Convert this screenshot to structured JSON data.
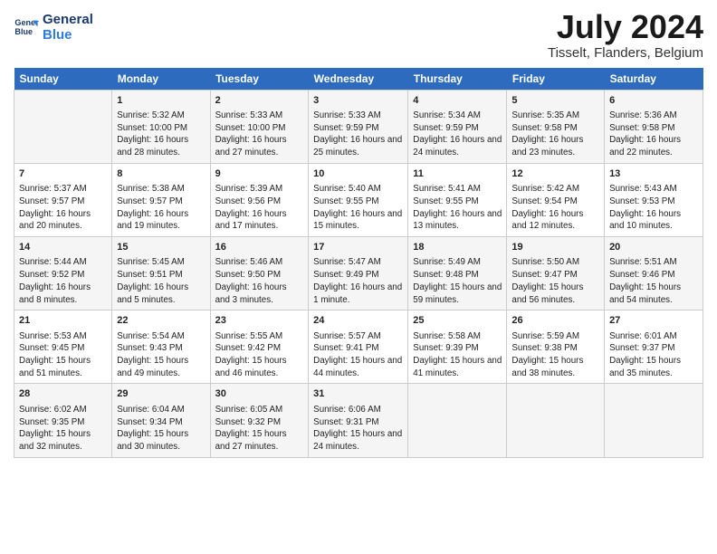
{
  "header": {
    "logo_line1": "General",
    "logo_line2": "Blue",
    "month": "July 2024",
    "location": "Tisselt, Flanders, Belgium"
  },
  "weekdays": [
    "Sunday",
    "Monday",
    "Tuesday",
    "Wednesday",
    "Thursday",
    "Friday",
    "Saturday"
  ],
  "weeks": [
    [
      {
        "day": "",
        "info": ""
      },
      {
        "day": "1",
        "info": "Sunrise: 5:32 AM\nSunset: 10:00 PM\nDaylight: 16 hours and 28 minutes."
      },
      {
        "day": "2",
        "info": "Sunrise: 5:33 AM\nSunset: 10:00 PM\nDaylight: 16 hours and 27 minutes."
      },
      {
        "day": "3",
        "info": "Sunrise: 5:33 AM\nSunset: 9:59 PM\nDaylight: 16 hours and 25 minutes."
      },
      {
        "day": "4",
        "info": "Sunrise: 5:34 AM\nSunset: 9:59 PM\nDaylight: 16 hours and 24 minutes."
      },
      {
        "day": "5",
        "info": "Sunrise: 5:35 AM\nSunset: 9:58 PM\nDaylight: 16 hours and 23 minutes."
      },
      {
        "day": "6",
        "info": "Sunrise: 5:36 AM\nSunset: 9:58 PM\nDaylight: 16 hours and 22 minutes."
      }
    ],
    [
      {
        "day": "7",
        "info": "Sunrise: 5:37 AM\nSunset: 9:57 PM\nDaylight: 16 hours and 20 minutes."
      },
      {
        "day": "8",
        "info": "Sunrise: 5:38 AM\nSunset: 9:57 PM\nDaylight: 16 hours and 19 minutes."
      },
      {
        "day": "9",
        "info": "Sunrise: 5:39 AM\nSunset: 9:56 PM\nDaylight: 16 hours and 17 minutes."
      },
      {
        "day": "10",
        "info": "Sunrise: 5:40 AM\nSunset: 9:55 PM\nDaylight: 16 hours and 15 minutes."
      },
      {
        "day": "11",
        "info": "Sunrise: 5:41 AM\nSunset: 9:55 PM\nDaylight: 16 hours and 13 minutes."
      },
      {
        "day": "12",
        "info": "Sunrise: 5:42 AM\nSunset: 9:54 PM\nDaylight: 16 hours and 12 minutes."
      },
      {
        "day": "13",
        "info": "Sunrise: 5:43 AM\nSunset: 9:53 PM\nDaylight: 16 hours and 10 minutes."
      }
    ],
    [
      {
        "day": "14",
        "info": "Sunrise: 5:44 AM\nSunset: 9:52 PM\nDaylight: 16 hours and 8 minutes."
      },
      {
        "day": "15",
        "info": "Sunrise: 5:45 AM\nSunset: 9:51 PM\nDaylight: 16 hours and 5 minutes."
      },
      {
        "day": "16",
        "info": "Sunrise: 5:46 AM\nSunset: 9:50 PM\nDaylight: 16 hours and 3 minutes."
      },
      {
        "day": "17",
        "info": "Sunrise: 5:47 AM\nSunset: 9:49 PM\nDaylight: 16 hours and 1 minute."
      },
      {
        "day": "18",
        "info": "Sunrise: 5:49 AM\nSunset: 9:48 PM\nDaylight: 15 hours and 59 minutes."
      },
      {
        "day": "19",
        "info": "Sunrise: 5:50 AM\nSunset: 9:47 PM\nDaylight: 15 hours and 56 minutes."
      },
      {
        "day": "20",
        "info": "Sunrise: 5:51 AM\nSunset: 9:46 PM\nDaylight: 15 hours and 54 minutes."
      }
    ],
    [
      {
        "day": "21",
        "info": "Sunrise: 5:53 AM\nSunset: 9:45 PM\nDaylight: 15 hours and 51 minutes."
      },
      {
        "day": "22",
        "info": "Sunrise: 5:54 AM\nSunset: 9:43 PM\nDaylight: 15 hours and 49 minutes."
      },
      {
        "day": "23",
        "info": "Sunrise: 5:55 AM\nSunset: 9:42 PM\nDaylight: 15 hours and 46 minutes."
      },
      {
        "day": "24",
        "info": "Sunrise: 5:57 AM\nSunset: 9:41 PM\nDaylight: 15 hours and 44 minutes."
      },
      {
        "day": "25",
        "info": "Sunrise: 5:58 AM\nSunset: 9:39 PM\nDaylight: 15 hours and 41 minutes."
      },
      {
        "day": "26",
        "info": "Sunrise: 5:59 AM\nSunset: 9:38 PM\nDaylight: 15 hours and 38 minutes."
      },
      {
        "day": "27",
        "info": "Sunrise: 6:01 AM\nSunset: 9:37 PM\nDaylight: 15 hours and 35 minutes."
      }
    ],
    [
      {
        "day": "28",
        "info": "Sunrise: 6:02 AM\nSunset: 9:35 PM\nDaylight: 15 hours and 32 minutes."
      },
      {
        "day": "29",
        "info": "Sunrise: 6:04 AM\nSunset: 9:34 PM\nDaylight: 15 hours and 30 minutes."
      },
      {
        "day": "30",
        "info": "Sunrise: 6:05 AM\nSunset: 9:32 PM\nDaylight: 15 hours and 27 minutes."
      },
      {
        "day": "31",
        "info": "Sunrise: 6:06 AM\nSunset: 9:31 PM\nDaylight: 15 hours and 24 minutes."
      },
      {
        "day": "",
        "info": ""
      },
      {
        "day": "",
        "info": ""
      },
      {
        "day": "",
        "info": ""
      }
    ]
  ]
}
